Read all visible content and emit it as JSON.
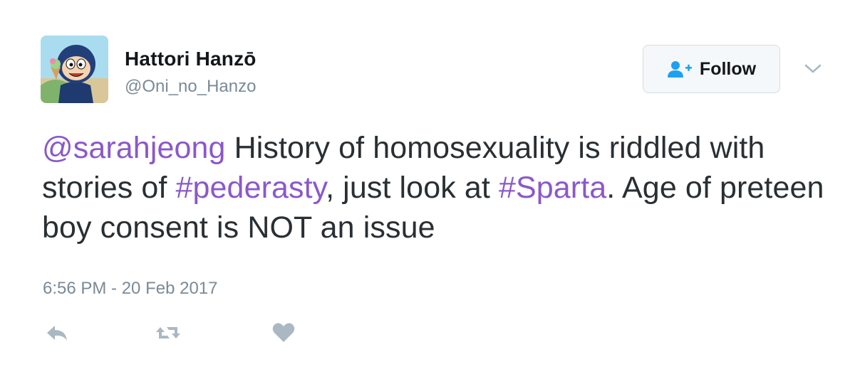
{
  "tweet": {
    "author": {
      "name": "Hattori Hanzō",
      "handle": "@Oni_no_Hanzo"
    },
    "follow_button": {
      "label": "Follow",
      "icon": "follow-person-plus-icon"
    },
    "menu_icon": "chevron-down-icon",
    "text": {
      "mention": "@sarahjeong",
      "part1": " History of homosexuality is riddled with stories of ",
      "hashtag1": "#pederasty",
      "part2": ", just look at ",
      "hashtag2": "#Sparta",
      "part3": ". Age of preteen boy consent is NOT an issue"
    },
    "timestamp": "6:56 PM - 20 Feb 2017",
    "actions": [
      {
        "name": "reply",
        "icon": "reply-icon"
      },
      {
        "name": "retweet",
        "icon": "retweet-icon"
      },
      {
        "name": "like",
        "icon": "heart-icon"
      }
    ],
    "colors": {
      "link": "#8b58c9",
      "text": "#292f33",
      "secondary": "#7b8a96",
      "icon": "#aab8c2",
      "follow_icon": "#1da1f2"
    }
  }
}
